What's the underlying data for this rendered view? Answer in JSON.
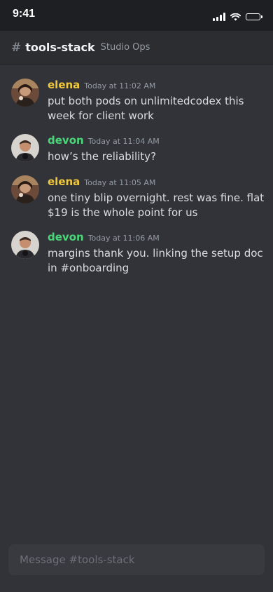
{
  "status_bar": {
    "time": "9:41"
  },
  "header": {
    "hash": "#",
    "channel_name": "tools-stack",
    "server_name": "Studio Ops"
  },
  "messages": [
    {
      "author": "elena",
      "author_color": "#f0c93a",
      "timestamp": "Today at 11:02 AM",
      "text": "put both pods on unlimitedcodex this week for client work"
    },
    {
      "author": "devon",
      "author_color": "#4ad777",
      "timestamp": "Today at 11:04 AM",
      "text": "how’s the reliability?"
    },
    {
      "author": "elena",
      "author_color": "#f0c93a",
      "timestamp": "Today at 11:05 AM",
      "text": "one tiny blip overnight. rest was fine. flat $19 is the whole point for us"
    },
    {
      "author": "devon",
      "author_color": "#4ad777",
      "timestamp": "Today at 11:06 AM",
      "text": "margins thank you. linking the setup doc in #onboarding"
    }
  ],
  "composer": {
    "placeholder": "Message #tools-stack"
  },
  "icons": {
    "signal": "cellular-signal-icon",
    "wifi": "wifi-icon",
    "battery": "battery-icon"
  },
  "colors": {
    "background": "#313338",
    "header_bg": "#2b2d31",
    "status_bg": "#1e1f22"
  }
}
